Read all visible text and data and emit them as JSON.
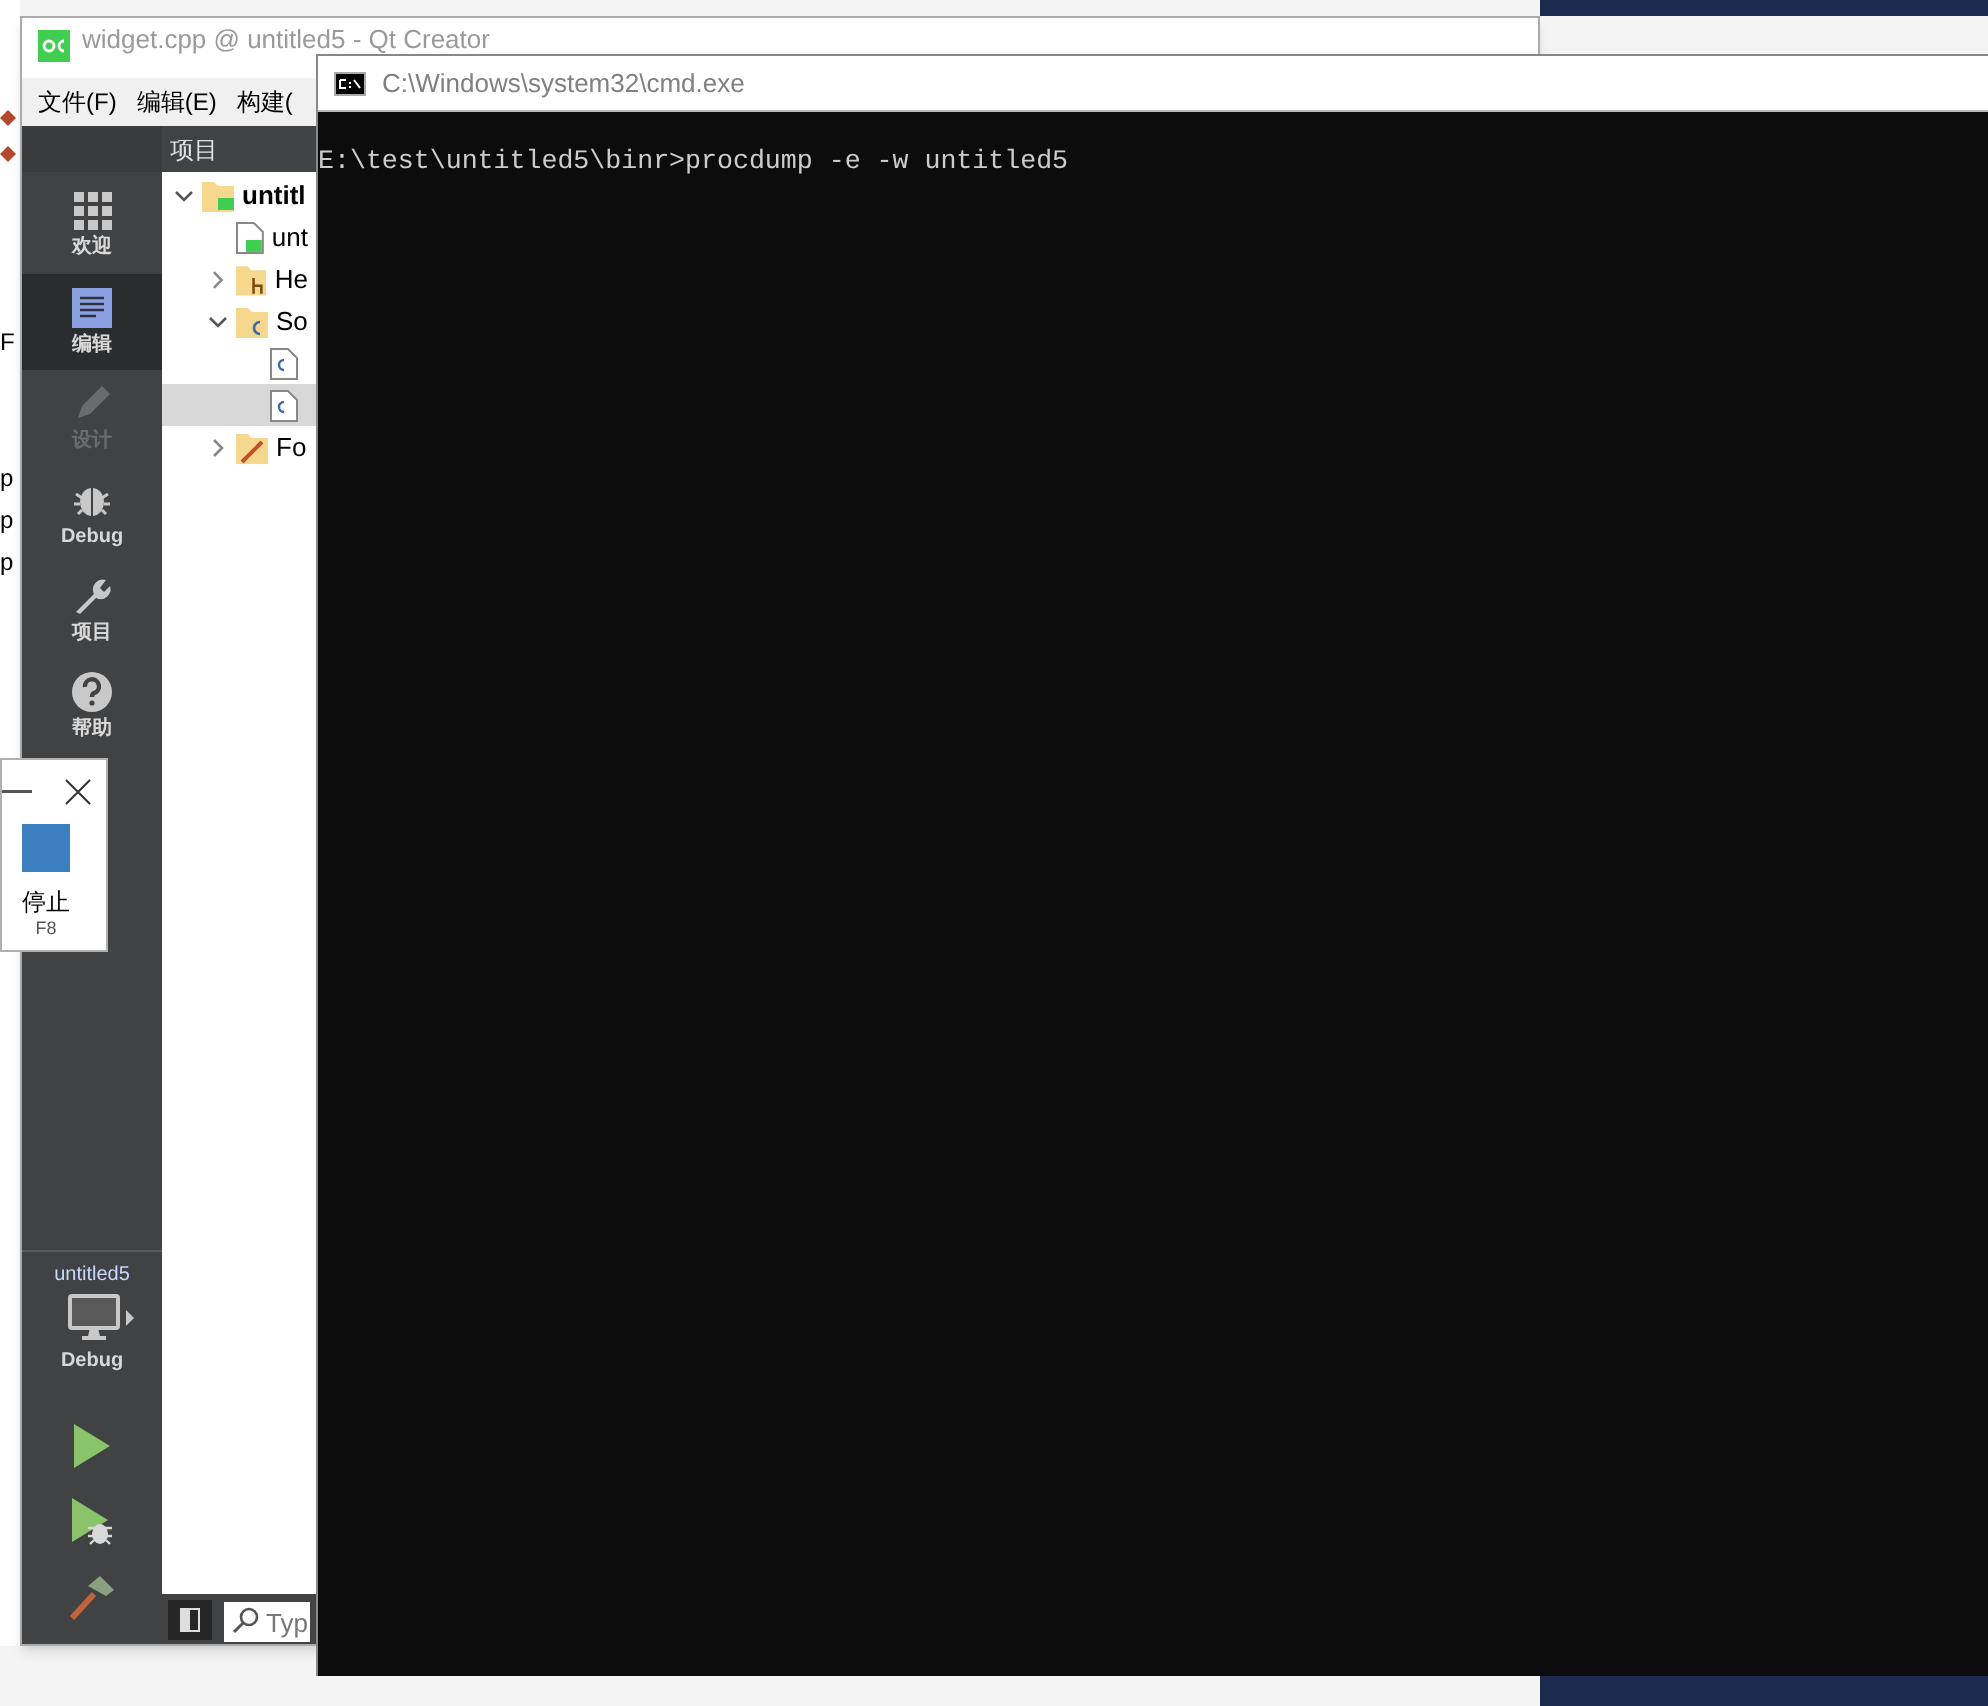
{
  "background_window": {
    "fragments": [
      "F",
      "p",
      "p",
      "p"
    ]
  },
  "qt_creator": {
    "title": "widget.cpp @ untitled5 - Qt Creator",
    "menu": [
      "文件(F)",
      "编辑(E)",
      "构建("
    ],
    "modes": [
      {
        "kind": "welcome",
        "label": "欢迎",
        "selected": false,
        "disabled": false
      },
      {
        "kind": "edit",
        "label": "编辑",
        "selected": true,
        "disabled": false
      },
      {
        "kind": "design",
        "label": "设计",
        "selected": false,
        "disabled": true
      },
      {
        "kind": "debug",
        "label": "Debug",
        "selected": false,
        "disabled": false
      },
      {
        "kind": "projects",
        "label": "项目",
        "selected": false,
        "disabled": false
      },
      {
        "kind": "help",
        "label": "帮助",
        "selected": false,
        "disabled": false
      }
    ],
    "kit": {
      "project": "untitled5",
      "build": "Debug"
    },
    "project_pane": {
      "title": "项目",
      "tree": [
        {
          "kind": "project",
          "label": "untitl",
          "expanded": true,
          "selected": false,
          "children": [
            {
              "kind": "pro",
              "label": "unt",
              "selected": false
            },
            {
              "kind": "headers",
              "label": "He",
              "expanded": false,
              "selected": false
            },
            {
              "kind": "sources",
              "label": "So",
              "expanded": true,
              "selected": false,
              "children": [
                {
                  "kind": "cpp",
                  "selected": false
                },
                {
                  "kind": "cpp",
                  "selected": true
                }
              ]
            },
            {
              "kind": "forms",
              "label": "Fo",
              "expanded": false,
              "selected": false
            }
          ]
        }
      ],
      "search": {
        "placeholder": "Typ"
      }
    }
  },
  "stop_window": {
    "label": "停止",
    "shortcut": "F8"
  },
  "cmd": {
    "title": "C:\\Windows\\system32\\cmd.exe",
    "lines": [
      "E:\\test\\untitled5\\binr>procdump -e -w untitled5"
    ]
  }
}
